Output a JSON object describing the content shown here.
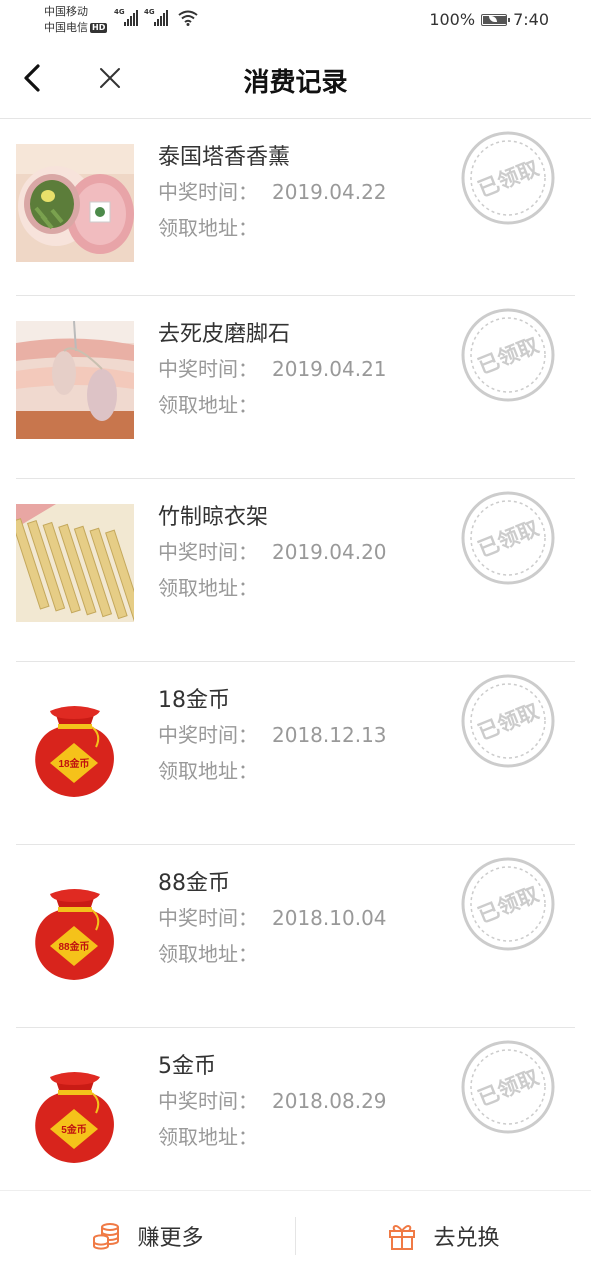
{
  "status_bar": {
    "carrier_1": "中国移动",
    "carrier_2": "中国电信",
    "hd": "HD",
    "network_1": "4G",
    "network_2": "4G",
    "battery_percent": "100%",
    "battery_level": 1.0,
    "time": "7:40"
  },
  "nav": {
    "title": "消费记录",
    "back_icon": "chevron-left-icon",
    "close_icon": "close-icon"
  },
  "labels": {
    "time_label": "中奖时间：",
    "address_label": "领取地址：",
    "stamp_text": "已领取"
  },
  "records": [
    {
      "name": "泰国塔香香薰",
      "date": "2019.04.22",
      "thumb": "aroma-photo"
    },
    {
      "name": "去死皮磨脚石",
      "date": "2019.04.21",
      "thumb": "pumice-photo"
    },
    {
      "name": "竹制晾衣架",
      "date": "2019.04.20",
      "thumb": "clothespin-photo"
    },
    {
      "name": "18金币",
      "date": "2018.12.13",
      "thumb": "coin-bag",
      "bag_label": "18金币"
    },
    {
      "name": "88金币",
      "date": "2018.10.04",
      "thumb": "coin-bag",
      "bag_label": "88金币"
    },
    {
      "name": "5金币",
      "date": "2018.08.29",
      "thumb": "coin-bag",
      "bag_label": "5金币"
    }
  ],
  "bottom_bar": {
    "earn_label": "赚更多",
    "exchange_label": "去兑换"
  },
  "colors": {
    "accent": "#f07a45",
    "stamp": "#cccccc",
    "bag_red": "#d8241c",
    "bag_yellow": "#f5c21a"
  }
}
